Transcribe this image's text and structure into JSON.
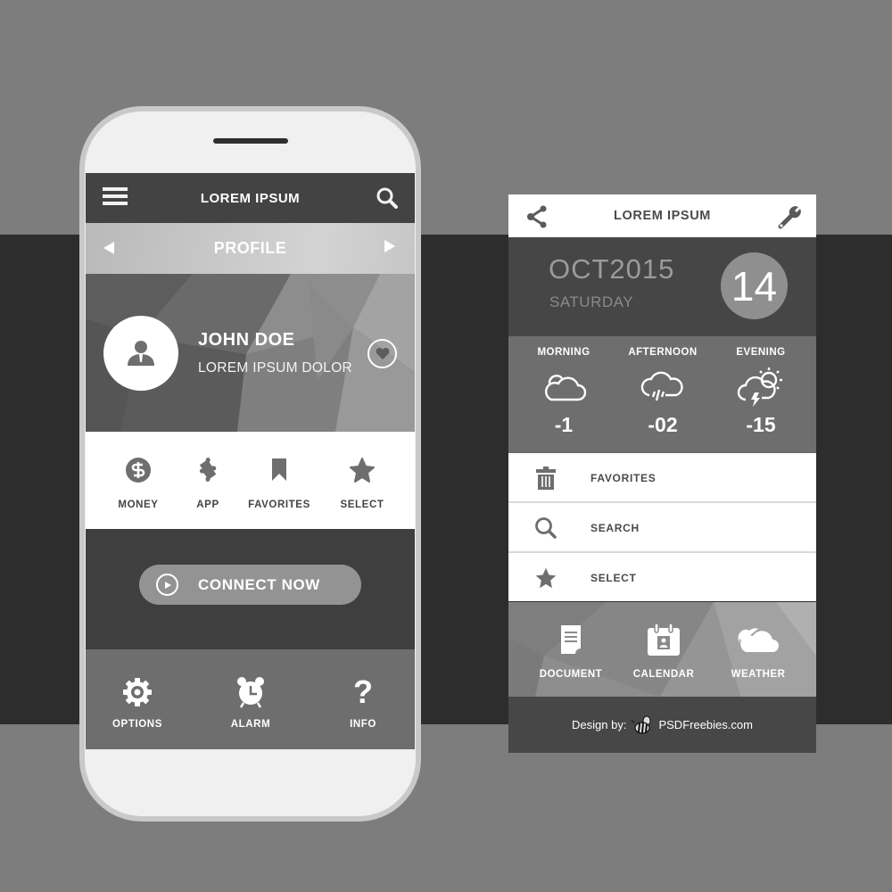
{
  "left_phone": {
    "header": {
      "title": "LOREM IPSUM",
      "menu_icon": "hamburger-menu-icon",
      "search_icon": "search-icon"
    },
    "profile_tab": {
      "title": "PROFILE",
      "prev_icon": "arrow-left-icon",
      "next_icon": "arrow-right-icon"
    },
    "profile": {
      "name": "JOHN DOE",
      "subtitle": "LOREM IPSUM DOLOR",
      "avatar_icon": "user-icon",
      "favorite_icon": "heart-icon"
    },
    "quick_actions": [
      {
        "label": "MONEY",
        "icon": "dollar-icon"
      },
      {
        "label": "APP",
        "icon": "puzzle-icon"
      },
      {
        "label": "FAVORITES",
        "icon": "bookmark-icon"
      },
      {
        "label": "SELECT",
        "icon": "star-icon"
      }
    ],
    "connect_button": {
      "label": "CONNECT NOW",
      "icon": "play-icon"
    },
    "bottom_nav": [
      {
        "label": "OPTIONS",
        "icon": "gear-icon"
      },
      {
        "label": "ALARM",
        "icon": "alarm-clock-icon"
      },
      {
        "label": "INFO",
        "icon": "question-icon"
      }
    ]
  },
  "right_panel": {
    "header": {
      "title": "LOREM IPSUM",
      "left_icon": "share-icon",
      "right_icon": "wrench-icon"
    },
    "date": {
      "month_year": "OCT2015",
      "weekday": "SATURDAY",
      "day": "14"
    },
    "weather": [
      {
        "label": "MORNING",
        "icon": "cloud-icon",
        "value": "-1"
      },
      {
        "label": "AFTERNOON",
        "icon": "rain-cloud-icon",
        "value": "-02"
      },
      {
        "label": "EVENING",
        "icon": "thunder-sun-cloud-icon",
        "value": "-15"
      }
    ],
    "list": [
      {
        "label": "FAVORITES",
        "icon": "trash-icon"
      },
      {
        "label": "SEARCH",
        "icon": "search-icon"
      },
      {
        "label": "SELECT",
        "icon": "star-icon"
      }
    ],
    "apps": [
      {
        "label": "DOCUMENT",
        "icon": "document-icon"
      },
      {
        "label": "CALENDAR",
        "icon": "calendar-icon"
      },
      {
        "label": "WEATHER",
        "icon": "weather-cloud-icon"
      }
    ],
    "credit": {
      "prefix": "Design by:",
      "brand": "PSDFreebies.com",
      "logo": "bee-logo-icon"
    }
  },
  "colors": {
    "background": "#7d7d7d",
    "band": "#2d2d2d",
    "phone_frame": "#c9c9c9",
    "dark_bar": "#434343",
    "mid_gray": "#6e6e6e",
    "button_gray": "#939393"
  }
}
